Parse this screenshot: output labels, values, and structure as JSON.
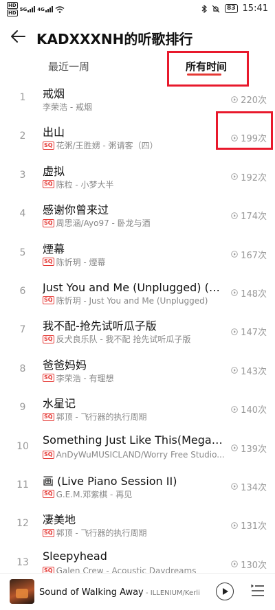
{
  "status_bar": {
    "sim1": "HD",
    "sim2": "HD",
    "net1": "5G",
    "net2": "4G",
    "battery": "83",
    "time": "15:41"
  },
  "header": {
    "title": "KADXXXNH的听歌排行"
  },
  "tabs": [
    {
      "label": "最近一周",
      "active": false
    },
    {
      "label": "所有时间",
      "active": true
    }
  ],
  "songs": [
    {
      "rank": "1",
      "title": "戒烟",
      "sq": false,
      "subtitle": "李荣浩 - 戒烟",
      "plays": "220次"
    },
    {
      "rank": "2",
      "title": "出山",
      "sq": true,
      "subtitle": "花粥/王胜娚 - 粥请客（四）",
      "plays": "199次"
    },
    {
      "rank": "3",
      "title": "虚拟",
      "sq": true,
      "subtitle": "陈粒 - 小梦大半",
      "plays": "192次"
    },
    {
      "rank": "4",
      "title": "感谢你曾来过",
      "sq": true,
      "subtitle": "周思涵/Ayo97 - 卧龙与酒",
      "plays": "174次"
    },
    {
      "rank": "5",
      "title": "煙幕",
      "sq": true,
      "subtitle": "陈忻玥 - 煙幕",
      "plays": "167次"
    },
    {
      "rank": "6",
      "title": "Just You and Me (Unplugged) (你...",
      "sq": true,
      "subtitle": "陈忻玥 - Just You and Me (Unplugged)",
      "plays": "148次"
    },
    {
      "rank": "7",
      "title": "我不配-抢先试听瓜子版",
      "sq": true,
      "subtitle": "反犬良乐队 - 我不配 抢先试听瓜子版",
      "plays": "147次"
    },
    {
      "rank": "8",
      "title": "爸爸妈妈",
      "sq": true,
      "subtitle": "李荣浩 - 有理想",
      "plays": "143次"
    },
    {
      "rank": "9",
      "title": "水星记",
      "sq": true,
      "subtitle": "郭顶 - 飞行器的执行周期",
      "plays": "140次"
    },
    {
      "rank": "10",
      "title": "Something Just Like This(Megamix)",
      "sq": true,
      "subtitle": "AnDyWuMUSICLAND/Worry Free Studio...",
      "plays": "139次"
    },
    {
      "rank": "11",
      "title": "画 (Live Piano Session II)",
      "sq": true,
      "subtitle": "G.E.M.邓紫棋 - 再见",
      "plays": "134次"
    },
    {
      "rank": "12",
      "title": "凄美地",
      "sq": true,
      "subtitle": "郭顶 - 飞行器的执行周期",
      "plays": "131次"
    },
    {
      "rank": "13",
      "title": "Sleepyhead",
      "sq": true,
      "subtitle": "Galen Crew - Acoustic Daydreams",
      "plays": "130次"
    }
  ],
  "sq_label": "SQ",
  "player": {
    "title": "Sound of Walking Away",
    "artist": " - ILLENIUM/Kerli"
  },
  "colors": {
    "accent": "#e53935",
    "annotation": "#e8192c"
  }
}
